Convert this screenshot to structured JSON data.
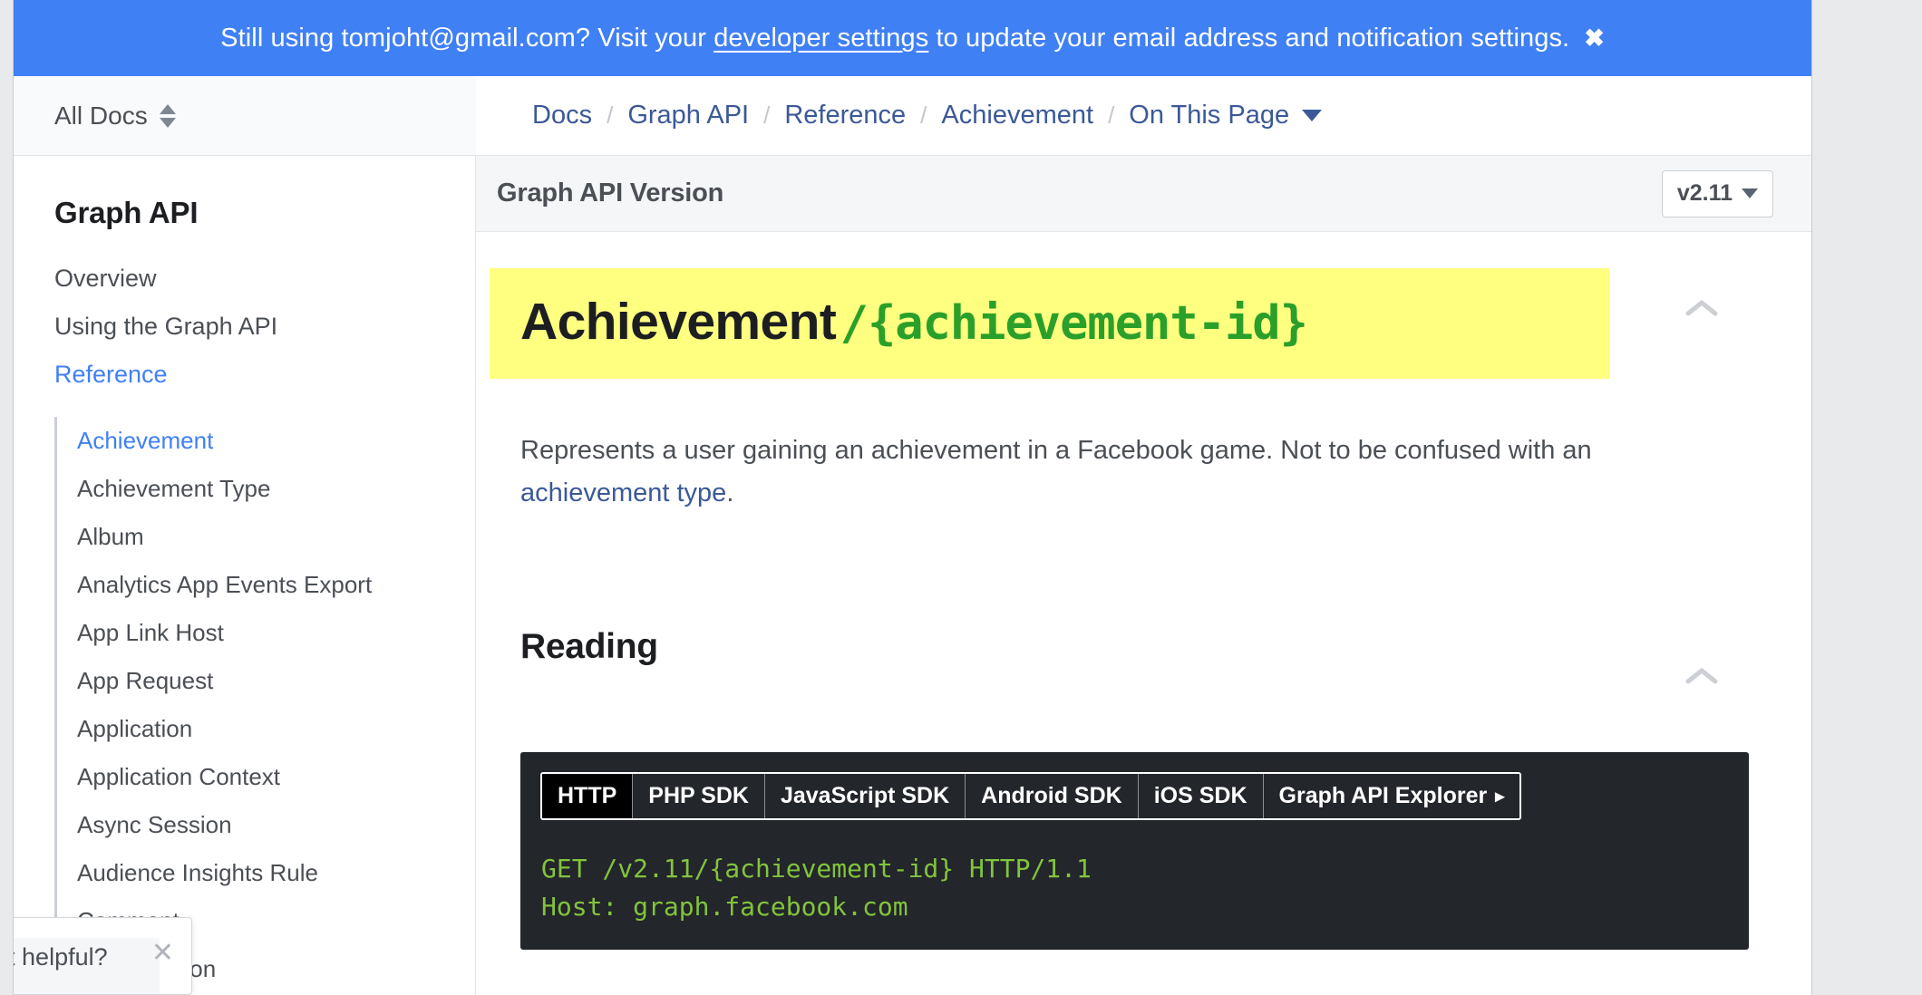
{
  "banner": {
    "text_before_link": "Still using tomjoht@gmail.com? Visit your ",
    "link_label": "developer settings",
    "text_after_link": " to update your email address and notification settings.",
    "close_icon": "close-icon",
    "close_glyph": "✖",
    "background_color": "#4080f5"
  },
  "docs_switcher": {
    "label": "All Docs",
    "icon": "sort-updown-icon"
  },
  "breadcrumb": {
    "items": [
      {
        "label": "Docs"
      },
      {
        "label": "Graph API"
      },
      {
        "label": "Reference"
      },
      {
        "label": "Achievement"
      },
      {
        "label": "On This Page"
      }
    ],
    "separator": "/",
    "caret_icon": "chevron-down-icon"
  },
  "sidebar": {
    "title": "Graph API",
    "top_items": [
      {
        "label": "Overview",
        "active": false
      },
      {
        "label": "Using the Graph API",
        "active": false
      },
      {
        "label": "Reference",
        "active": true
      }
    ],
    "sub_items": [
      {
        "label": "Achievement",
        "active": true
      },
      {
        "label": "Achievement Type",
        "active": false
      },
      {
        "label": "Album",
        "active": false
      },
      {
        "label": "Analytics App Events Export",
        "active": false
      },
      {
        "label": "App Link Host",
        "active": false
      },
      {
        "label": "App Request",
        "active": false
      },
      {
        "label": "Application",
        "active": false
      },
      {
        "label": "Application Context",
        "active": false
      },
      {
        "label": "Async Session",
        "active": false
      },
      {
        "label": "Audience Insights Rule",
        "active": false
      },
      {
        "label": "Comment",
        "active": false
      },
      {
        "label": "Conversation",
        "active": false
      }
    ]
  },
  "version_bar": {
    "label": "Graph API Version",
    "selected_version": "v2.11",
    "caret_icon": "chevron-down-icon"
  },
  "main": {
    "title_name": "Achievement",
    "title_path": "/{achievement-id}",
    "highlight_color": "#ffff80",
    "path_color": "#2aa02a",
    "paragraph_text": "Represents a user gaining an achievement in a Facebook game. Not to be confused with an ",
    "paragraph_link": "achievement type",
    "paragraph_tail": ".",
    "section_heading": "Reading",
    "collapse_icon": "chevron-up-icon"
  },
  "code_block": {
    "tabs": [
      {
        "label": "HTTP",
        "active": true,
        "arrow": ""
      },
      {
        "label": "PHP SDK",
        "active": false,
        "arrow": ""
      },
      {
        "label": "JavaScript SDK",
        "active": false,
        "arrow": ""
      },
      {
        "label": "Android SDK",
        "active": false,
        "arrow": ""
      },
      {
        "label": "iOS SDK",
        "active": false,
        "arrow": ""
      },
      {
        "label": "Graph API Explorer",
        "active": false,
        "arrow": "▸"
      }
    ],
    "code": "GET /v2.11/{achievement-id} HTTP/1.1\nHost: graph.facebook.com",
    "background_color": "#23262b",
    "text_color": "#82c43c"
  },
  "feedback_popup": {
    "text": "cument helpful?",
    "close_icon": "close-icon",
    "close_glyph": "✕"
  }
}
